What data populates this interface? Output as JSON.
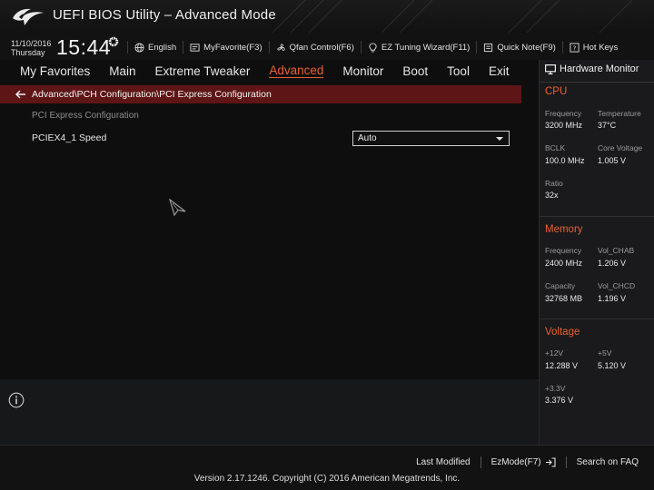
{
  "app": {
    "title": "UEFI BIOS Utility – Advanced Mode"
  },
  "infobar": {
    "date": "11/10/2016",
    "day": "Thursday",
    "time": "15:44",
    "items": [
      {
        "icon": "globe-icon",
        "label": "English"
      },
      {
        "icon": "favorite-icon",
        "label": "MyFavorite(F3)"
      },
      {
        "icon": "fan-icon",
        "label": "Qfan Control(F6)"
      },
      {
        "icon": "bulb-icon",
        "label": "EZ Tuning Wizard(F11)"
      },
      {
        "icon": "note-icon",
        "label": "Quick Note(F9)"
      },
      {
        "icon": "help-icon",
        "label": "Hot Keys"
      }
    ]
  },
  "menu": {
    "items": [
      "My Favorites",
      "Main",
      "Extreme Tweaker",
      "Advanced",
      "Monitor",
      "Boot",
      "Tool",
      "Exit"
    ],
    "active": "Advanced"
  },
  "breadcrumb": {
    "path": "Advanced\\PCH Configuration\\PCI Express Configuration"
  },
  "content": {
    "section_label": "PCI Express Configuration",
    "setting_label": "PCIEX4_1 Speed",
    "setting_value": "Auto"
  },
  "hw_monitor": {
    "title": "Hardware Monitor",
    "cpu": {
      "title": "CPU",
      "frequency_label": "Frequency",
      "frequency": "3200 MHz",
      "temperature_label": "Temperature",
      "temperature": "37°C",
      "bclk_label": "BCLK",
      "bclk": "100.0 MHz",
      "core_voltage_label": "Core Voltage",
      "core_voltage": "1.005 V",
      "ratio_label": "Ratio",
      "ratio": "32x"
    },
    "memory": {
      "title": "Memory",
      "frequency_label": "Frequency",
      "frequency": "2400 MHz",
      "vol_chab_label": "Vol_CHAB",
      "vol_chab": "1.206 V",
      "capacity_label": "Capacity",
      "capacity": "32768 MB",
      "vol_chcd_label": "Vol_CHCD",
      "vol_chcd": "1.196 V"
    },
    "voltage": {
      "title": "Voltage",
      "v12_label": "+12V",
      "v12": "12.288 V",
      "v5_label": "+5V",
      "v5": "5.120 V",
      "v33_label": "+3.3V",
      "v33": "3.376 V"
    }
  },
  "bottom": {
    "last_modified": "Last Modified",
    "ezmode": "EzMode(F7)",
    "search": "Search on FAQ",
    "version": "Version 2.17.1246. Copyright (C) 2016 American Megatrends, Inc."
  },
  "colors": {
    "accent": "#e8612f",
    "breadcrumb_bg": "#5e1515",
    "background": "#0e0e0f"
  }
}
